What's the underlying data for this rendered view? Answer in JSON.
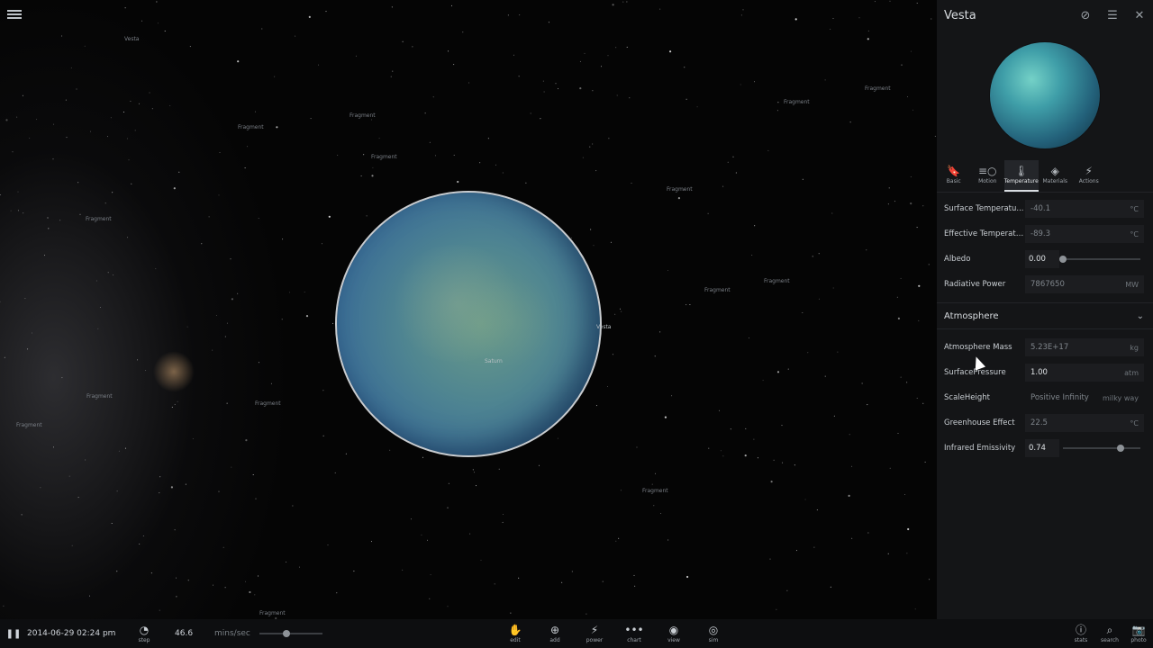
{
  "viewport": {
    "fragment_label": "Fragment",
    "body_labels": [
      "Vesta",
      "Saturn",
      "Vesta"
    ]
  },
  "panel": {
    "title": "Vesta",
    "header_icons": [
      "hide-icon",
      "list-icon",
      "close-icon"
    ],
    "tabs": [
      {
        "label": "Basic",
        "icon": "bookmark-icon",
        "glyph": "🔖"
      },
      {
        "label": "Motion",
        "icon": "motion-icon",
        "glyph": "≡○"
      },
      {
        "label": "Temperature",
        "icon": "thermometer-icon",
        "glyph": "🌡"
      },
      {
        "label": "Materials",
        "icon": "materials-icon",
        "glyph": "◈"
      },
      {
        "label": "Actions",
        "icon": "lightning-icon",
        "glyph": "⚡"
      }
    ],
    "active_tab": "Temperature",
    "rows": {
      "surface_temperature": {
        "label": "Surface Temperatu...",
        "value": "-40.1",
        "unit": "°C"
      },
      "effective_temperature": {
        "label": "Effective Temperatu...",
        "value": "-89.3",
        "unit": "°C"
      },
      "albedo": {
        "label": "Albedo",
        "value": "0.00",
        "fraction": 0.0
      },
      "radiative_power": {
        "label": "Radiative Power",
        "value": "7867650",
        "unit": "MW"
      }
    },
    "section_atmosphere": "Atmosphere",
    "atmo_rows": {
      "atmosphere_mass": {
        "label": "Atmosphere Mass",
        "value": "5.23E+17",
        "unit": "kg"
      },
      "surface_pressure": {
        "label": "SurfacePressure",
        "value": "1.00",
        "unit": "atm"
      },
      "scale_height": {
        "label": "ScaleHeight",
        "value": "Positive Infinity",
        "unit": "milky way"
      },
      "greenhouse_effect": {
        "label": "Greenhouse Effect",
        "value": "22.5",
        "unit": "°C"
      },
      "infrared_emissivity": {
        "label": "Infrared Emissivity",
        "value": "0.74",
        "fraction": 0.74
      }
    }
  },
  "bottombar": {
    "date": "2014-06-29 02:24 pm",
    "step_label": "step",
    "speed": "46.6",
    "speed_unit": "mins/sec",
    "tools": [
      {
        "label": "edit",
        "icon": "hand-icon",
        "glyph": "✋"
      },
      {
        "label": "add",
        "icon": "add-icon",
        "glyph": "⊕"
      },
      {
        "label": "power",
        "icon": "power-icon",
        "glyph": "⚡"
      },
      {
        "label": "chart",
        "icon": "chart-icon",
        "glyph": "•••"
      },
      {
        "label": "view",
        "icon": "eye-icon",
        "glyph": "◉"
      },
      {
        "label": "sim",
        "icon": "sim-icon",
        "glyph": "◎"
      }
    ],
    "right_tools": [
      {
        "label": "stats",
        "icon": "info-icon",
        "glyph": "ⓘ"
      },
      {
        "label": "search",
        "icon": "search-icon",
        "glyph": "⌕"
      },
      {
        "label": "photo",
        "icon": "camera-icon",
        "glyph": "📷"
      }
    ]
  }
}
